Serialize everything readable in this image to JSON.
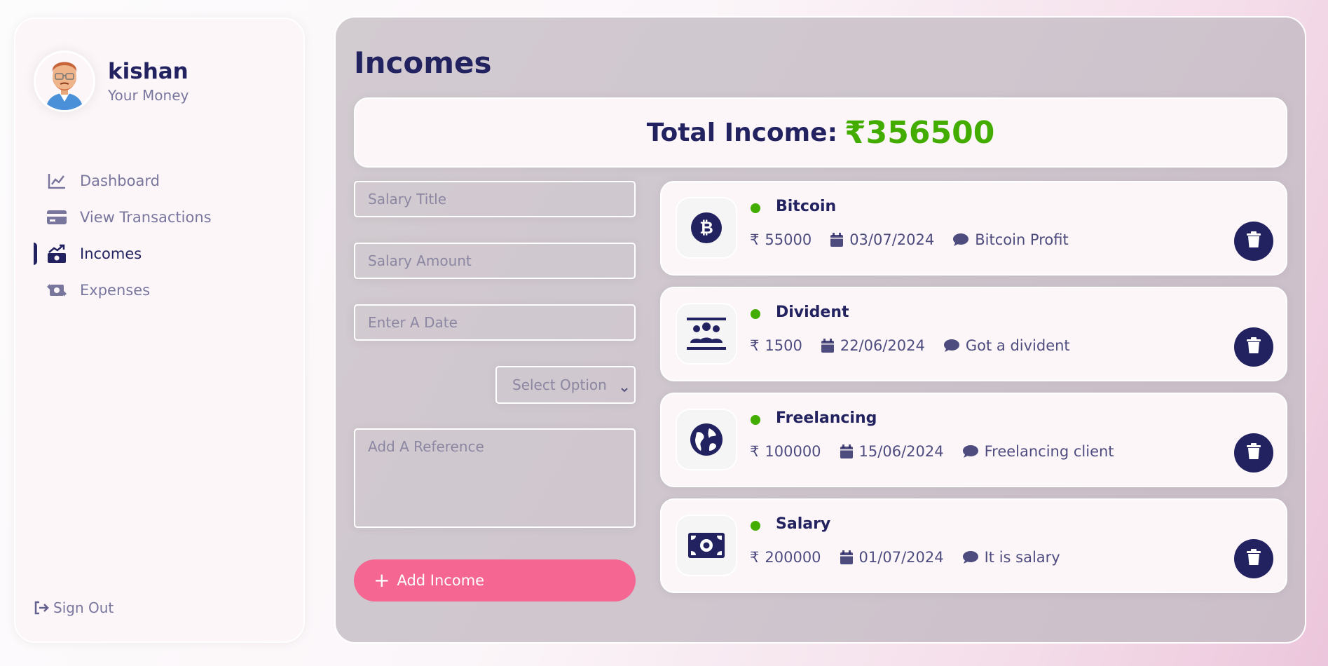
{
  "user": {
    "name": "kishan",
    "subtitle": "Your Money"
  },
  "nav": {
    "items": [
      {
        "label": "Dashboard",
        "icon": "chart-line-icon"
      },
      {
        "label": "View Transactions",
        "icon": "credit-card-icon"
      },
      {
        "label": "Incomes",
        "icon": "money-trend-icon",
        "active": true
      },
      {
        "label": "Expenses",
        "icon": "money-transfer-icon"
      }
    ],
    "signout": "Sign Out"
  },
  "page": {
    "title": "Incomes"
  },
  "total": {
    "label": "Total Income:",
    "amount": "₹356500"
  },
  "form": {
    "title_placeholder": "Salary Title",
    "amount_placeholder": "Salary Amount",
    "date_placeholder": "Enter A Date",
    "select_label": "Select Option",
    "reference_placeholder": "Add A Reference",
    "add_label": "Add Income"
  },
  "currency_symbol": "₹",
  "incomes": [
    {
      "title": "Bitcoin",
      "amount": "55000",
      "date": "03/07/2024",
      "description": "Bitcoin Profit",
      "icon": "bitcoin-icon"
    },
    {
      "title": "Divident",
      "amount": "1500",
      "date": "22/06/2024",
      "description": "Got a divident",
      "icon": "users-between-lines-icon"
    },
    {
      "title": "Freelancing",
      "amount": "100000",
      "date": "15/06/2024",
      "description": "Freelancing client",
      "icon": "globe-icon"
    },
    {
      "title": "Salary",
      "amount": "200000",
      "date": "01/07/2024",
      "description": "It is salary",
      "icon": "money-bill-icon"
    }
  ],
  "colors": {
    "primary": "#222260",
    "accent": "#F56692",
    "green": "#42AD00"
  }
}
